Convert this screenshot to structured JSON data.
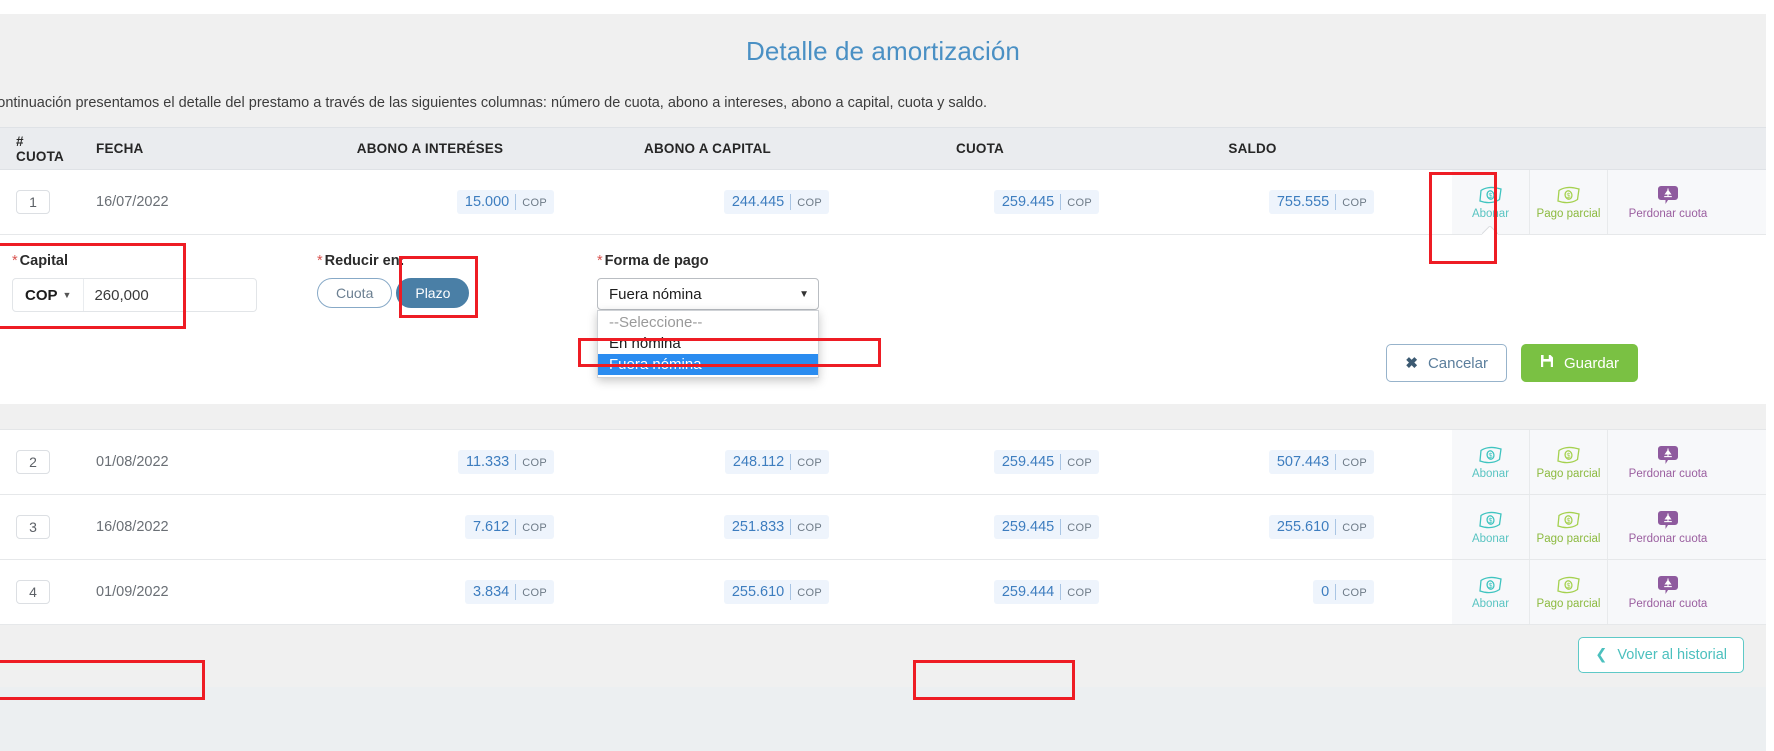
{
  "page": {
    "title": "Detalle de amortización",
    "intro": "continuación presentamos el detalle del prestamo a través de las siguientes columnas: número de cuota, abono a intereses, abono a capital, cuota y saldo.",
    "accent_color": "#4a90c4",
    "currency_code": "COP"
  },
  "table": {
    "columns": {
      "num": "# CUOTA",
      "date": "FECHA",
      "interest": "ABONO A INTERÉSES",
      "capital": "ABONO A CAPITAL",
      "installment": "CUOTA",
      "balance": "SALDO"
    },
    "rows": [
      {
        "num": "1",
        "date": "16/07/2022",
        "interest": "15.000",
        "interest_cur": "COP",
        "capital": "244.445",
        "capital_cur": "COP",
        "installment": "259.445",
        "installment_cur": "COP",
        "balance": "755.555",
        "balance_cur": "COP"
      },
      {
        "num": "2",
        "date": "01/08/2022",
        "interest": "11.333",
        "interest_cur": "COP",
        "capital": "248.112",
        "capital_cur": "COP",
        "installment": "259.445",
        "installment_cur": "COP",
        "balance": "507.443",
        "balance_cur": "COP"
      },
      {
        "num": "3",
        "date": "16/08/2022",
        "interest": "7.612",
        "interest_cur": "COP",
        "capital": "251.833",
        "capital_cur": "COP",
        "installment": "259.445",
        "installment_cur": "COP",
        "balance": "255.610",
        "balance_cur": "COP"
      },
      {
        "num": "4",
        "date": "01/09/2022",
        "interest": "3.834",
        "interest_cur": "COP",
        "capital": "255.610",
        "capital_cur": "COP",
        "installment": "259.444",
        "installment_cur": "COP",
        "balance": "0",
        "balance_cur": "COP"
      }
    ],
    "actions": {
      "abonar": "Abonar",
      "pago_parcial": "Pago parcial",
      "perdonar_cuota": "Perdonar cuota",
      "abonar_color": "#59c4c2",
      "pago_parcial_color": "#8cba3f",
      "perdonar_color": "#9b5fa0"
    }
  },
  "form": {
    "capital": {
      "label": "Capital",
      "required_mark": "*",
      "currency": "COP",
      "value": "260,000"
    },
    "reducir": {
      "label": "Reducir en:",
      "required_mark": "*",
      "option_cuota": "Cuota",
      "option_plazo": "Plazo",
      "selected": "Plazo"
    },
    "forma_pago": {
      "label": "Forma de pago",
      "required_mark": "*",
      "selected": "Fuera nómina",
      "options": [
        "--Seleccione--",
        "En nómina",
        "Fuera nómina"
      ],
      "highlighted_option": "Fuera nómina"
    },
    "buttons": {
      "cancel": "Cancelar",
      "save": "Guardar",
      "cancel_icon": "close-x-icon",
      "save_icon": "floppy-disk-icon"
    }
  },
  "footer": {
    "back_button": "Volver al historial",
    "back_icon": "chevron-left-icon",
    "back_color": "#4cc0be"
  }
}
